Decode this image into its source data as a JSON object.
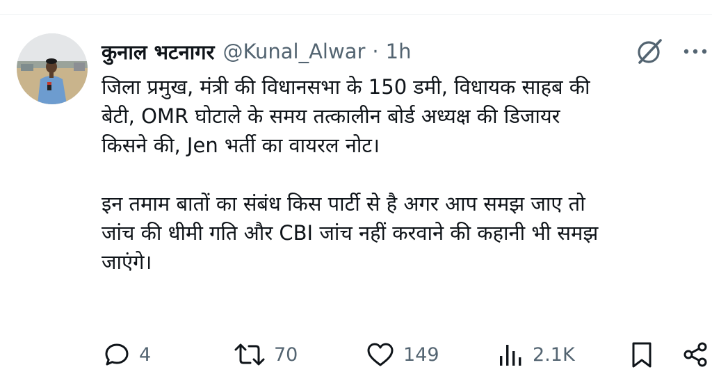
{
  "tweet": {
    "display_name": "कुनाल भटनागर",
    "handle": "@Kunal_Alwar",
    "separator": "·",
    "time": "1h",
    "lines": [
      "जिला प्रमुख, मंत्री की विधानसभा के 150 डमी, विधायक साहब की",
      "बेटी, OMR घोटाले के समय तत्कालीन बोर्ड अध्यक्ष की डिजायर",
      "किसने की, Jen भर्ती का वायरल नोट।",
      "इन तमाम बातों का संबंध किस पार्टी से है अगर आप समझ जाए तो",
      "जांच की धीमी गति और CBI जांच नहीं करवाने की कहानी भी समझ",
      "जाएंगे।"
    ]
  },
  "actions": {
    "replies": "4",
    "reposts": "70",
    "likes": "149",
    "views": "2.1K"
  },
  "icons": {
    "grok": "grok-icon",
    "more": "more-icon",
    "reply": "reply-icon",
    "repost": "repost-icon",
    "like": "heart-icon",
    "views": "views-icon",
    "bookmark": "bookmark-icon",
    "share": "share-icon"
  },
  "colors": {
    "text": "#0f1419",
    "secondary": "#536471",
    "divider": "#eff3f4"
  }
}
